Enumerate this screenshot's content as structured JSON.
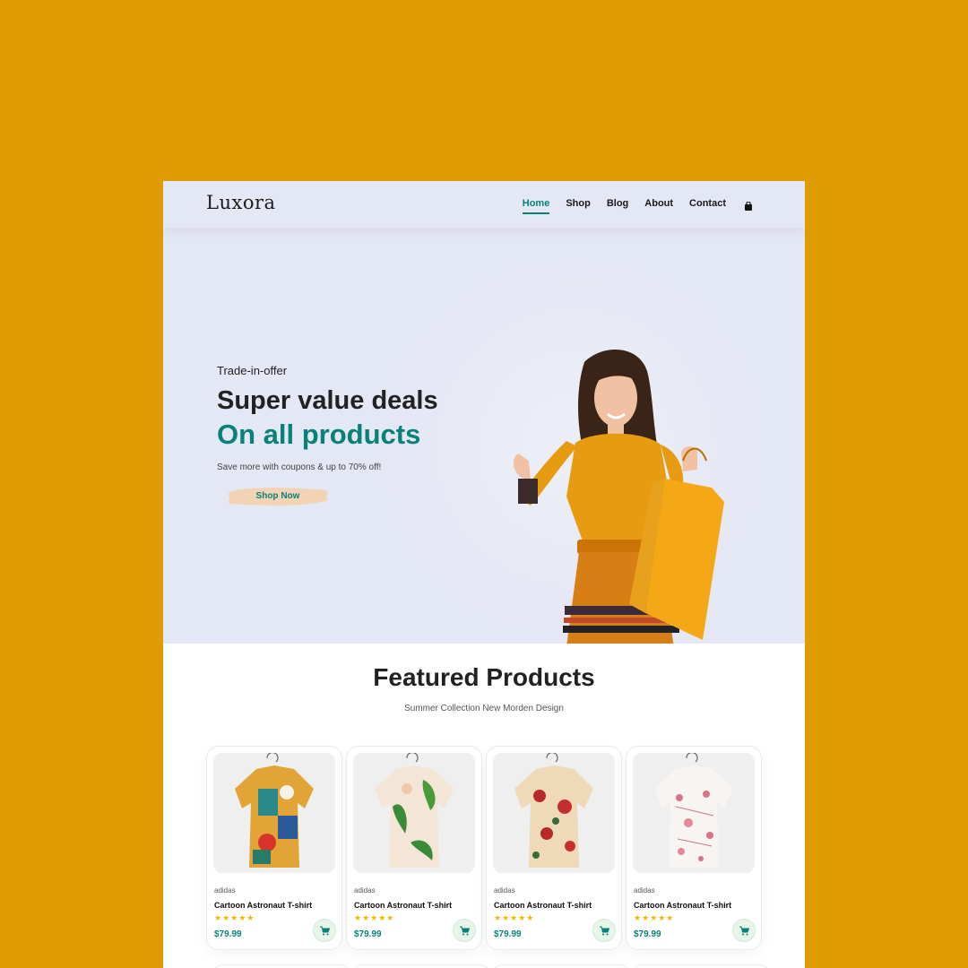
{
  "colors": {
    "background": "#DE9C02",
    "accent": "#088178",
    "hero_bg": "#E4E7F4",
    "star": "#F2B600"
  },
  "header": {
    "logo": "Luxora",
    "nav": [
      "Home",
      "Shop",
      "Blog",
      "About",
      "Contact"
    ],
    "active": "Home",
    "cart_icon": "shopping-bag-icon"
  },
  "hero": {
    "offer": "Trade-in-offer",
    "title": "Super value deals",
    "highlight": "On all products",
    "subtitle": "Save more with coupons & up to 70% off!",
    "button": "Shop Now"
  },
  "featured": {
    "title": "Featured Products",
    "subtitle": "Summer Collection New Morden Design",
    "products": [
      {
        "brand": "adidas",
        "name": "Cartoon Astronaut T-shirt",
        "stars": "★★★★★",
        "rating": 5,
        "price": "$79.99",
        "pattern": "tropical-multicolor"
      },
      {
        "brand": "adidas",
        "name": "Cartoon Astronaut T-shirt",
        "stars": "★★★★★",
        "rating": 5,
        "price": "$79.99",
        "pattern": "green-leaf"
      },
      {
        "brand": "adidas",
        "name": "Cartoon Astronaut T-shirt",
        "stars": "★★★★★",
        "rating": 5,
        "price": "$79.99",
        "pattern": "red-floral"
      },
      {
        "brand": "adidas",
        "name": "Cartoon Astronaut T-shirt",
        "stars": "★★★★★",
        "rating": 5,
        "price": "$79.99",
        "pattern": "pink-floral"
      }
    ]
  }
}
